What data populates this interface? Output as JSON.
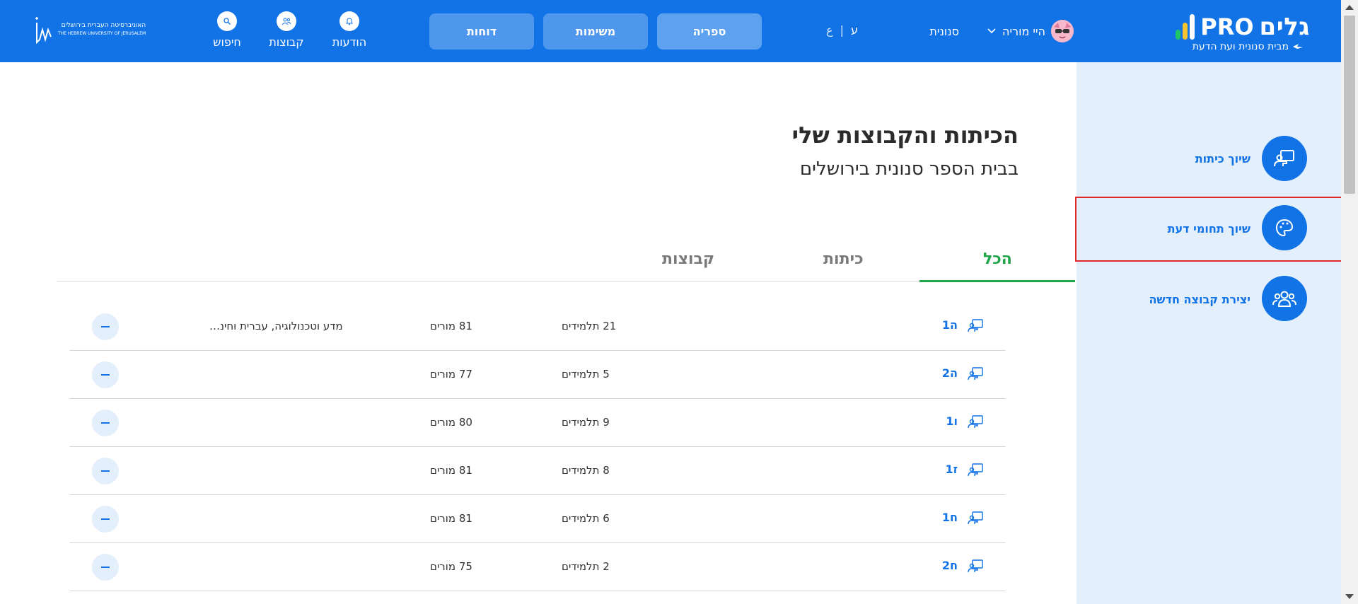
{
  "header": {
    "brand": {
      "name": "גלים",
      "pro": "PRO",
      "tagline": "מבית סנונית ועת הדעת",
      "bar_colors": [
        "#1ec46a",
        "#f7c331",
        "#ffffff"
      ]
    },
    "user": {
      "greeting": "היי מוריה"
    },
    "school": "סנונית",
    "language": {
      "active": "ע",
      "inactive": "ع"
    },
    "nav": {
      "library": "ספריה",
      "tasks": "משימות",
      "reports": "דוחות"
    },
    "tools": {
      "messages": "הודעות",
      "groups": "קבוצות",
      "search": "חיפוש"
    },
    "huji": {
      "he": "האוניברסיטה העברית בירושלים",
      "en": "THE HEBREW UNIVERSITY OF JERUSALEM"
    }
  },
  "sidebar": {
    "items": [
      {
        "label": "שיוך כיתות",
        "icon": "teacher-board-icon"
      },
      {
        "label": "שיוך תחומי דעת",
        "icon": "palette-icon"
      },
      {
        "label": "יצירת קבוצה חדשה",
        "icon": "users-group-icon"
      }
    ]
  },
  "main": {
    "title": "הכיתות והקבוצות שלי",
    "subtitle": "בבית הספר סנונית בירושלים",
    "tabs": {
      "all": "הכל",
      "classes": "כיתות",
      "groups": "קבוצות"
    },
    "rows": [
      {
        "name": "ה1",
        "students": "21 תלמידים",
        "teachers": "81 מורים",
        "subjects": "מדע וטכנולוגיה, עברית וחינ…"
      },
      {
        "name": "ה2",
        "students": "5 תלמידים",
        "teachers": "77 מורים",
        "subjects": ""
      },
      {
        "name": "ו1",
        "students": "9 תלמידים",
        "teachers": "80 מורים",
        "subjects": ""
      },
      {
        "name": "ז1",
        "students": "8 תלמידים",
        "teachers": "81 מורים",
        "subjects": ""
      },
      {
        "name": "ח1",
        "students": "6 תלמידים",
        "teachers": "81 מורים",
        "subjects": ""
      },
      {
        "name": "ח2",
        "students": "2 תלמידים",
        "teachers": "75 מורים",
        "subjects": ""
      }
    ]
  },
  "colors": {
    "primary": "#1173e6",
    "accent_green": "#20a54a",
    "sidebar_bg": "#e3effb",
    "highlight": "#e0282d"
  }
}
